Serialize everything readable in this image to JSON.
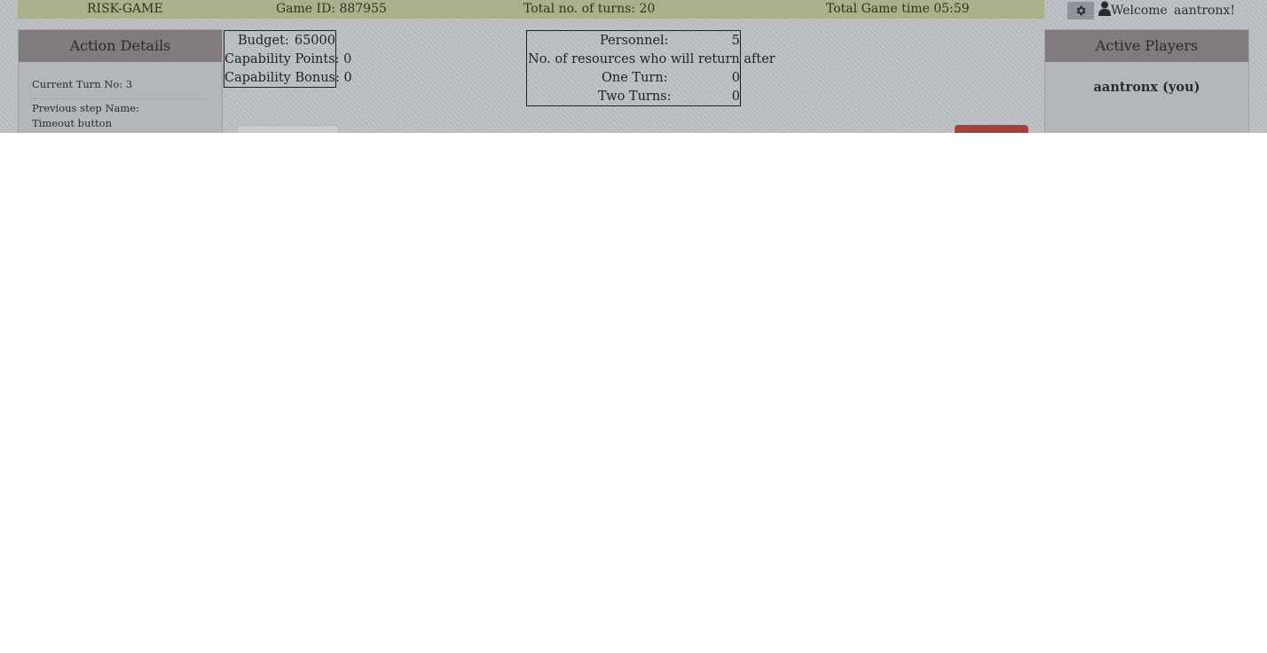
{
  "topbar": {
    "game_name": "RISK-GAME",
    "game_id": "Game ID: 887955",
    "total_turns": "Total no. of turns: 20",
    "total_time": "Total Game time 05:59"
  },
  "user": {
    "settings_icon": "gear-icon",
    "user_icon": "user-icon",
    "welcome": "Welcome",
    "username": "aantronx!"
  },
  "action_details": {
    "title": "Action Details",
    "current_turn": "Current Turn No: 3",
    "previous_step_label": "Previous step Name:",
    "previous_step_value": "Timeout button"
  },
  "resources": {
    "budget_label": "Budget:",
    "budget_value": "65000",
    "capability_points": "Capability Points: 0",
    "capability_bonus": "Capability Bonus: 0"
  },
  "personnel": {
    "personnel_label": "Personnel:",
    "personnel_value": "5",
    "return_header": "No. of resources who will return after",
    "one_turn_label": "One Turn:",
    "one_turn_value": "0",
    "two_turns_label": "Two Turns:",
    "two_turns_value": "0"
  },
  "active_players": {
    "title": "Active Players",
    "players": [
      "aantronx (you)"
    ]
  },
  "colors": {
    "overlay_bg": "#bcbfc4",
    "topbar_bg": "#a9b08b",
    "panel_header": "#827b7d",
    "danger_button": "#a7403d"
  }
}
